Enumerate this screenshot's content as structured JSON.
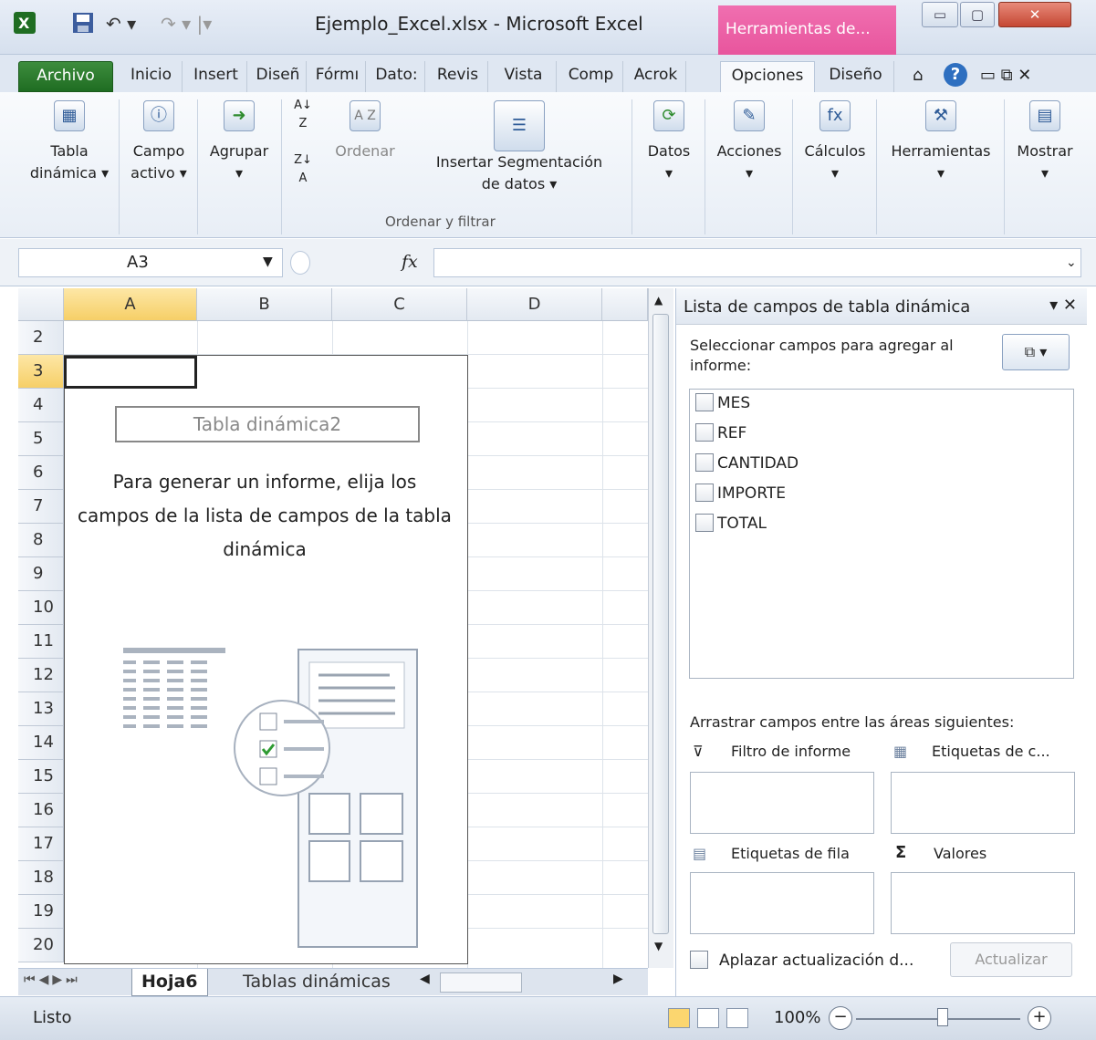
{
  "titlebar": {
    "title": "Ejemplo_Excel.xlsx - Microsoft Excel",
    "context_tab": "Herramientas de...",
    "icons": [
      "excel-icon",
      "save-icon",
      "undo-icon",
      "redo-icon"
    ]
  },
  "tabs": [
    "Archivo",
    "Inicio",
    "Insert",
    "Diseñ",
    "Fórmı",
    "Dato:",
    "Revis",
    "Vista",
    "Comp",
    "Acrok",
    "Opciones",
    "Diseño"
  ],
  "ribbon": {
    "tabla": "Tabla\ndinámica ▾",
    "campo": "Campo\nactivo ▾",
    "agrupar": "Agrupar\n▾",
    "ordenar": "Ordenar",
    "segmentacion": "Insertar Segmentación\nde datos ▾",
    "group_label": "Ordenar y filtrar",
    "datos": "Datos\n▾",
    "acciones": "Acciones\n▾",
    "calculos": "Cálculos\n▾",
    "herramientas": "Herramientas\n▾",
    "mostrar": "Mostrar\n▾"
  },
  "formula": {
    "namebox": "A3",
    "fx": "fx"
  },
  "grid": {
    "columns": [
      "A",
      "B",
      "C",
      "D"
    ],
    "rows": [
      "2",
      "3",
      "4",
      "5",
      "6",
      "7",
      "8",
      "9",
      "10",
      "11",
      "12",
      "13",
      "14",
      "15",
      "16",
      "17",
      "18",
      "19",
      "20"
    ],
    "pivot_title": "Tabla dinámica2",
    "pivot_message": "Para generar un informe, elija los campos de la lista de campos de la tabla dinámica"
  },
  "pane": {
    "title": "Lista de campos de tabla dinámica",
    "subtitle": "Seleccionar campos para agregar al informe:",
    "fields": [
      "MES",
      "REF",
      "CANTIDAD",
      "IMPORTE",
      "TOTAL"
    ],
    "drag_msg": "Arrastrar campos entre las áreas siguientes:",
    "filtro": "Filtro de informe",
    "etiq_col": "Etiquetas de c...",
    "etiq_fila": "Etiquetas de fila",
    "valores": "Valores",
    "defer": "Aplazar actualización d...",
    "update": "Actualizar"
  },
  "sheets": {
    "active": "Hoja6",
    "other": "Tablas dinámicas"
  },
  "status": {
    "text": "Listo",
    "zoom": "100%"
  }
}
